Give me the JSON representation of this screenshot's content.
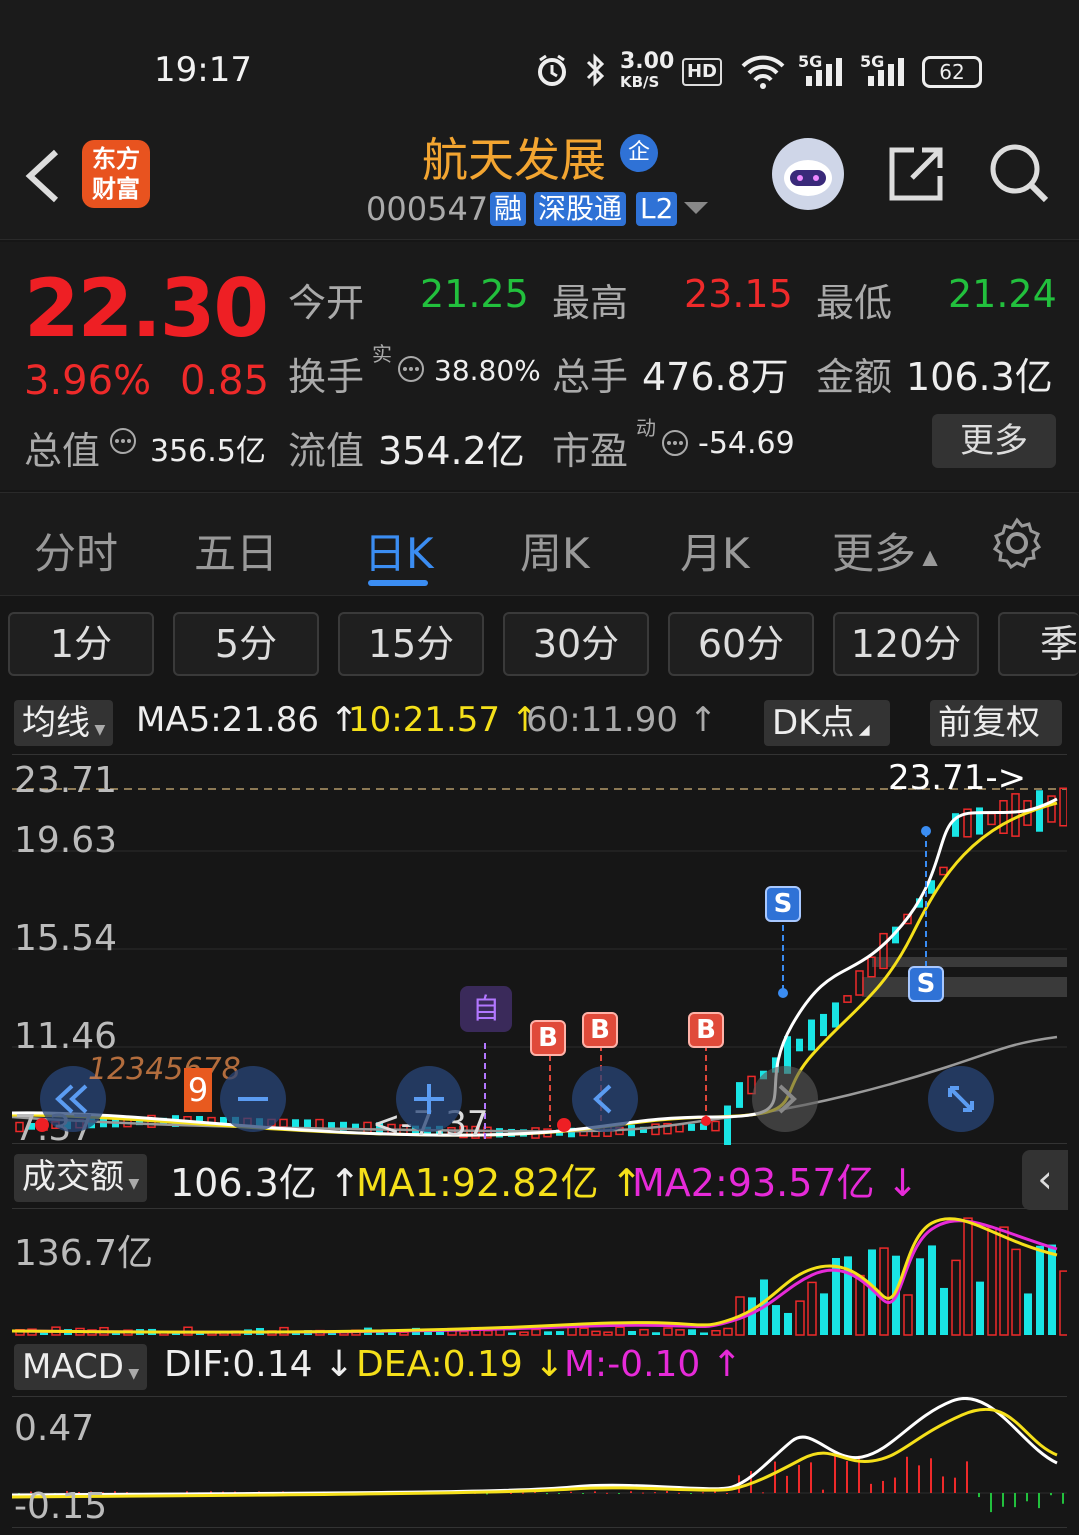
{
  "status_bar": {
    "time": "19:17",
    "net_speed": "3.00",
    "net_unit": "KB/S",
    "hd": "HD",
    "sig1": "5G",
    "sig2": "5G",
    "battery": "62"
  },
  "header": {
    "app_logo": "东方财富",
    "stock_name": "航天发展",
    "stock_badge": "企",
    "code": "000547",
    "tags": [
      "融",
      "深股通",
      "L2"
    ]
  },
  "quote": {
    "price": "22.30",
    "change_pct": "3.96%",
    "change_amt": "0.85",
    "open_label": "今开",
    "open": "21.25",
    "high_label": "最高",
    "high": "23.15",
    "low_label": "最低",
    "low": "21.24",
    "turnover_label": "换手",
    "turnover_sup": "实",
    "turnover": "38.80%",
    "volume_label": "总手",
    "volume": "476.8万",
    "amount_label": "金额",
    "amount": "106.3亿",
    "mcap_label": "总值",
    "mcap": "356.5亿",
    "float_label": "流值",
    "float": "354.2亿",
    "pe_label": "市盈",
    "pe_sup": "动",
    "pe": "-54.69",
    "more": "更多"
  },
  "tabs": [
    "分时",
    "五日",
    "日K",
    "周K",
    "月K",
    "更多"
  ],
  "periods": [
    "1分",
    "5分",
    "15分",
    "30分",
    "60分",
    "120分",
    "季"
  ],
  "ma_bar": {
    "selector": "均线",
    "ma5": "MA5:21.86",
    "ma10": "10:21.57",
    "ma60": "60:11.90",
    "dk": "DK点",
    "adjust": "前复权"
  },
  "kline": {
    "y_labels": [
      "23.71",
      "19.63",
      "15.54",
      "11.46",
      "7.37"
    ],
    "high_marker": "23.71->",
    "low_marker": "<-7.37",
    "zoom_digits": "12345678",
    "zoom_active": "9",
    "markers": {
      "self": "自",
      "buy": "B",
      "sell": "S"
    }
  },
  "volume": {
    "selector": "成交额",
    "value": "106.3亿",
    "ma1": "MA1:92.82亿",
    "ma2": "MA2:93.57亿",
    "y_label": "136.7亿"
  },
  "macd": {
    "selector": "MACD",
    "dif": "DIF:0.14",
    "dea": "DEA:0.19",
    "m": "M:-0.10",
    "y_top": "0.47",
    "y_bottom": "-0.15"
  },
  "colors": {
    "up": "#ee2a2a",
    "down": "#22c03d",
    "accent": "#3b8df2",
    "ma5": "#ffffff",
    "ma10": "#f5e01a",
    "ma60": "#9a9a9a",
    "ma2": "#e62ad8",
    "bar_down": "#19e5e5"
  }
}
